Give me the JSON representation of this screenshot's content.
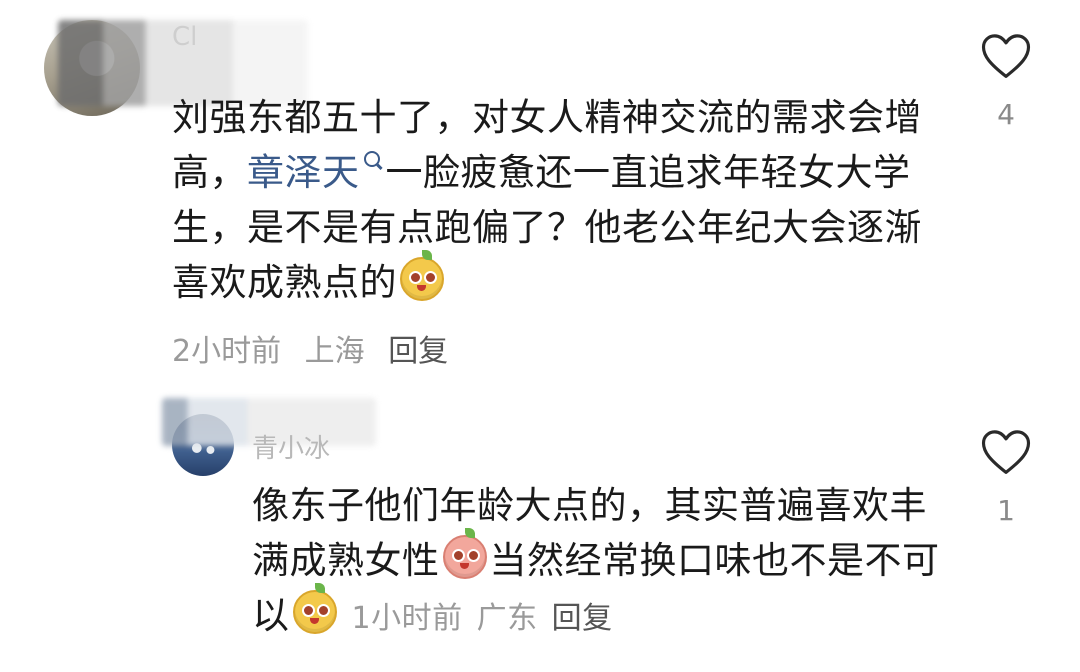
{
  "comments": [
    {
      "author_name": "Cl",
      "text_before_mention": "刘强东都五十了，对女人精神交流的需求会增高，",
      "mention": "章泽天",
      "text_after_mention": "一脸疲惫还一直追求年轻女大学生，是不是有点跑偏了？他老公年纪大会逐渐喜欢成熟点的",
      "trailing_emoji": "yellow-smile-emoji",
      "meta": {
        "time": "2小时前",
        "location": "上海",
        "reply_label": "回复"
      },
      "likes": {
        "icon": "heart-outline-icon",
        "count": "4"
      }
    },
    {
      "author_name": "青小冰",
      "text_part1": "像东子他们年龄大点的，其实普遍喜欢丰满成熟女性",
      "inline_emoji_1": "pink-smile-emoji",
      "text_part2": "当然经常换口味也不是不可以",
      "inline_emoji_2": "yellow-smile-emoji",
      "meta": {
        "time": "1小时前",
        "location": "广东",
        "reply_label": "回复"
      },
      "likes": {
        "icon": "heart-outline-icon",
        "count": "1"
      }
    }
  ]
}
